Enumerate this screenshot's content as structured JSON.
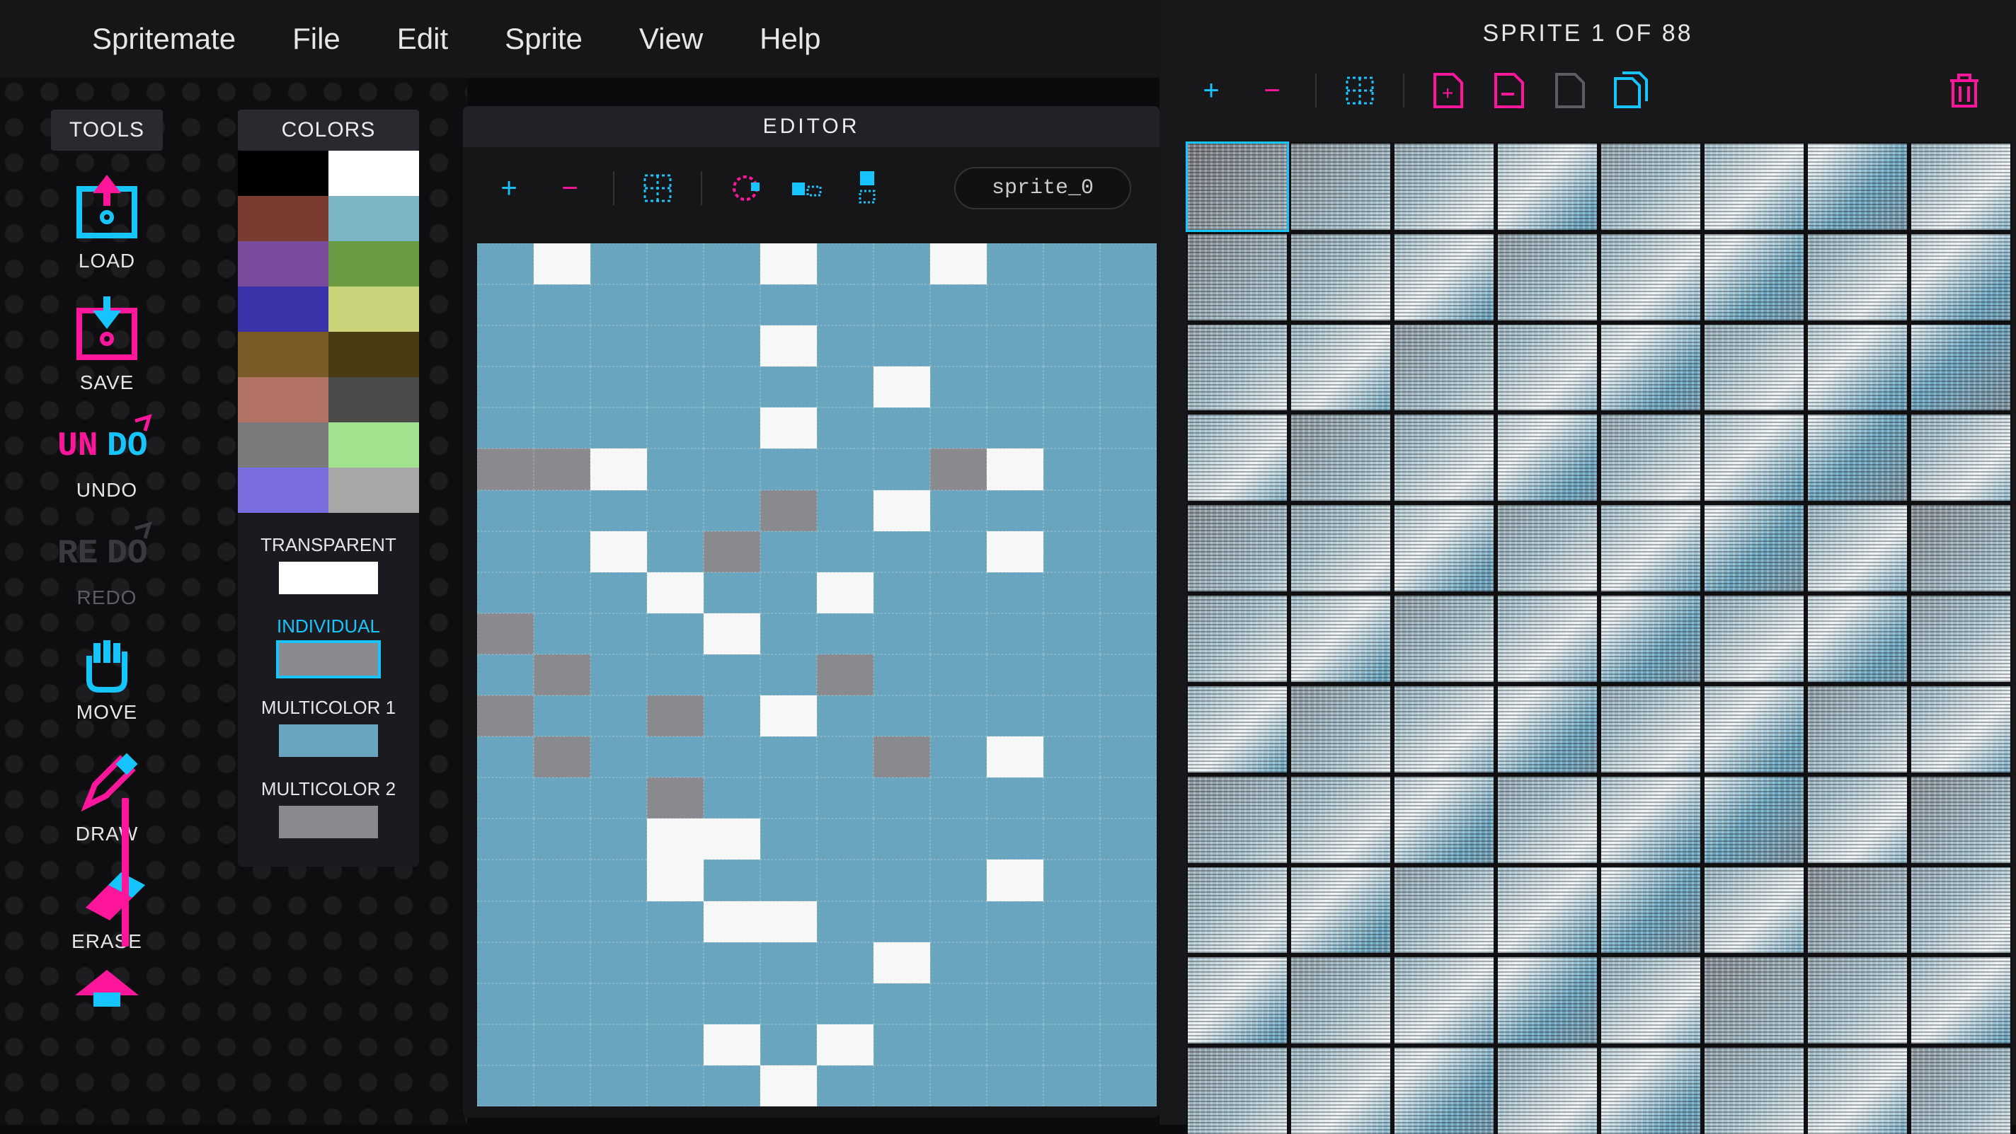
{
  "menu": {
    "app": "Spritemate",
    "file": "File",
    "edit": "Edit",
    "sprite": "Sprite",
    "view": "View",
    "help": "Help"
  },
  "tools": {
    "title": "TOOLS",
    "items": [
      {
        "label": "LOAD",
        "icon": "load",
        "color": "#16c4ff"
      },
      {
        "label": "SAVE",
        "icon": "save",
        "color": "#ff169b"
      },
      {
        "label": "UNDO",
        "icon": "undo",
        "color": "#ff169b",
        "accent": "#16c4ff"
      },
      {
        "label": "REDO",
        "icon": "redo",
        "disabled": true
      },
      {
        "label": "MOVE",
        "icon": "move",
        "color": "#16c4ff"
      },
      {
        "label": "DRAW",
        "icon": "draw",
        "color": "#ff169b",
        "active": true
      },
      {
        "label": "ERASE",
        "icon": "erase",
        "color": "#ff169b",
        "accent": "#16c4ff"
      }
    ]
  },
  "colors": {
    "title": "COLORS",
    "palette": [
      "#000000",
      "#ffffff",
      "#7a3b31",
      "#7cb6c6",
      "#7a4a9c",
      "#6a9a42",
      "#3a32a8",
      "#cbd37a",
      "#7a5a26",
      "#4a3c12",
      "#b17264",
      "#4a4a4a",
      "#7a7a7a",
      "#a2e28e",
      "#7a6ee0",
      "#a8a8a8"
    ],
    "slots": {
      "transparent": {
        "label": "TRANSPARENT",
        "value": "#ffffff"
      },
      "individual": {
        "label": "INDIVIDUAL",
        "value": "#8a8a8e",
        "selected": true
      },
      "multicolor1": {
        "label": "MULTICOLOR 1",
        "value": "#6aa5c0"
      },
      "multicolor2": {
        "label": "MULTICOLOR 2",
        "value": "#8a8a8e"
      }
    }
  },
  "editor": {
    "title": "EDITOR",
    "zoom_in": "+",
    "zoom_out": "−",
    "sprite_name": "sprite_0",
    "grid": [
      "BWBBBWBBWBBB",
      "BBBBBBBBBBBB",
      "BBBBBWBBBBBB",
      "BBBBBBBWBBBB",
      "BBBBBWBBBBBB",
      "GGWBBBBBGWBB",
      "BBBBBGBWBBBB",
      "BBWBGBBBBWBB",
      "BBBWBBWBBBBB",
      "GBBBWBBBBBBB",
      "BGBBBBGBBBBB",
      "GBBGBWBBBBBB",
      "BGBBBBBGBWBB",
      "BBBGBBBBBBBB",
      "BBBWWBBBBBBB",
      "BBBWBBBBBWBB",
      "BBBBWWBBBBBB",
      "BBBBBBBWBBBB",
      "BBBBBBBBBBBB",
      "BBBBWBWBBBBB",
      "BBBBBWBBBBBB"
    ]
  },
  "list": {
    "title": "SPRITE 1 OF 88",
    "zoom_in": "+",
    "zoom_out": "−",
    "count": 88
  },
  "icons": {
    "grid": "grid",
    "shiftL": "shift-l",
    "shiftR": "shift-r",
    "flip": "flip",
    "new": "new",
    "copy": "copy",
    "paste": "paste",
    "dup": "duplicate",
    "trash": "trash"
  }
}
